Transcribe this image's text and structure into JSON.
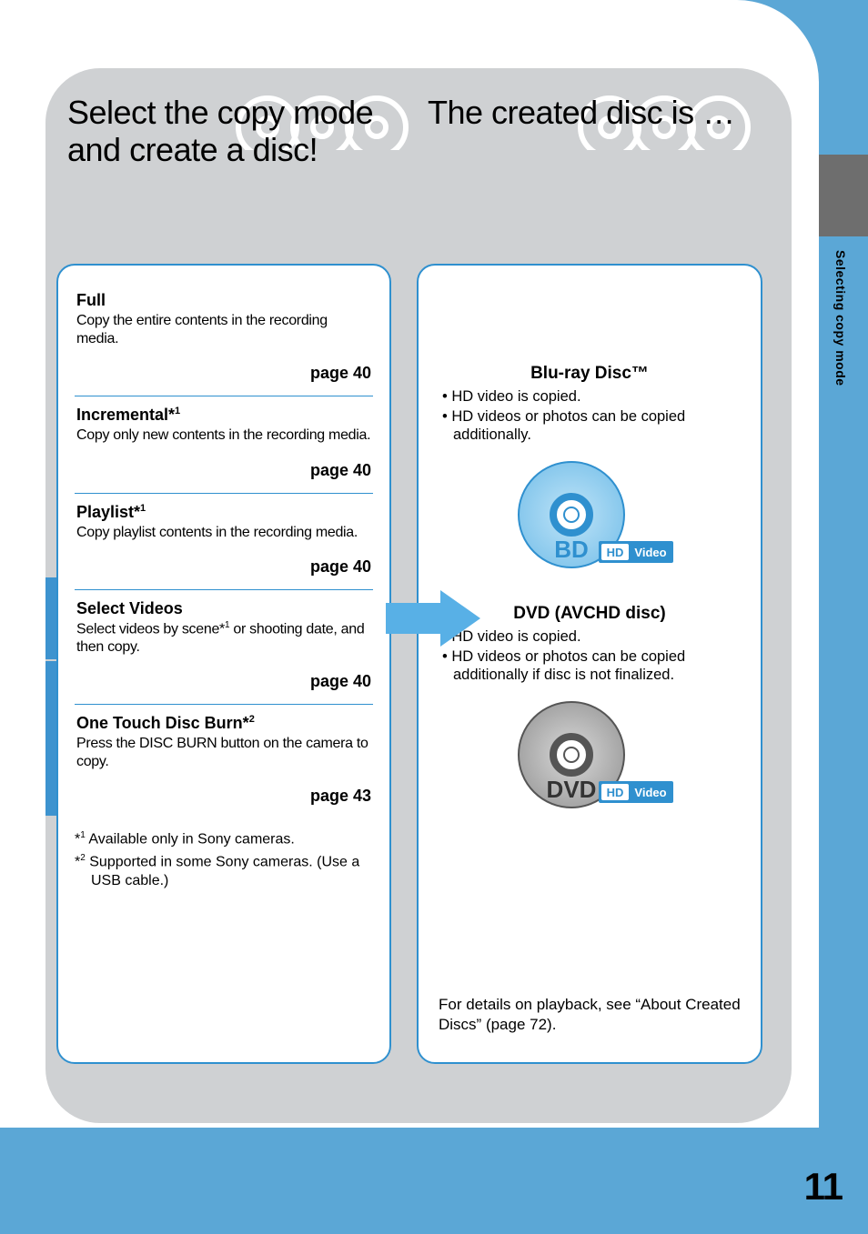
{
  "side_label": "Selecting copy mode",
  "page_number": "11",
  "left": {
    "heading": "Select the copy mode and create a disc!",
    "modes": [
      {
        "title": "Full",
        "sup": "",
        "desc": "Copy the entire contents in the recording media.",
        "page": "page 40"
      },
      {
        "title": "Incremental*",
        "sup": "1",
        "desc": "Copy only new contents in the recording media.",
        "page": "page 40"
      },
      {
        "title": "Playlist*",
        "sup": "1",
        "desc": "Copy playlist contents in the recording media.",
        "page": "page 40"
      },
      {
        "title": "Select Videos",
        "sup": "",
        "desc": "Select videos by scene*1 or shooting date, and then copy.",
        "page": "page 40"
      },
      {
        "title": "One Touch Disc Burn*",
        "sup": "2",
        "desc": "Press the DISC BURN button on the camera to copy.",
        "page": "page 43"
      }
    ],
    "footnotes": [
      "*1 Available only in Sony cameras.",
      "*2 Supported in some Sony cameras. (Use a USB cable.)"
    ]
  },
  "right": {
    "heading": "The created disc is …",
    "sections": [
      {
        "title": "Blu-ray Disc™",
        "bullets": [
          "HD video is copied.",
          "HD videos or photos can be copied additionally."
        ],
        "disc_label": "BD",
        "badge_hd": "HD",
        "badge_video": "Video",
        "color": "#2f90cf"
      },
      {
        "title": "DVD (AVCHD disc)",
        "bullets": [
          "HD video is copied.",
          "HD videos or photos can be copied additionally if disc is not finalized."
        ],
        "disc_label": "DVD",
        "badge_hd": "HD",
        "badge_video": "Video",
        "color": "#555555"
      }
    ],
    "bottom_note": "For details on playback, see “About Created Discs” (page 72)."
  }
}
